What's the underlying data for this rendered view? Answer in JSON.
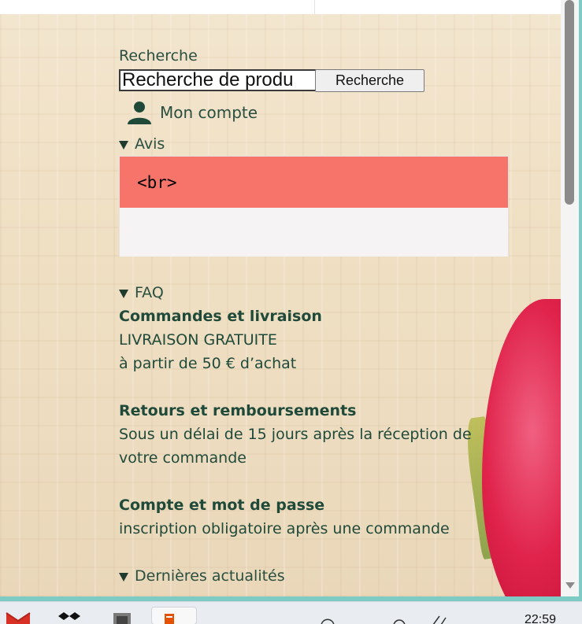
{
  "search": {
    "label": "Recherche",
    "input_value": "Recherche de produ",
    "button_label": "Recherche"
  },
  "account": {
    "label": "Mon compte",
    "icon": "user-icon"
  },
  "avis": {
    "summary": "Avis",
    "header_text": "<br>"
  },
  "faq": {
    "summary": "FAQ",
    "items": [
      {
        "title": "Commandes et livraison",
        "lines": [
          "LIVRAISON GRATUITE",
          "à partir de 50 € d’achat"
        ]
      },
      {
        "title": "Retours et remboursements",
        "lines": [
          "Sous un délai de 15 jours après la réception de",
          "votre commande"
        ]
      },
      {
        "title": "Compte et mot de passe",
        "lines": [
          "inscription obligatoire après une commande"
        ]
      }
    ]
  },
  "news": {
    "summary": "Dernières actualités"
  },
  "taskbar": {
    "clock": "22:59",
    "icons": [
      "gmail-icon",
      "dropbox-icon",
      "app-icon",
      "document-icon"
    ]
  },
  "colors": {
    "text": "#1f4a3a",
    "alert": "#f7746a",
    "accent": "#7ecbc6"
  }
}
